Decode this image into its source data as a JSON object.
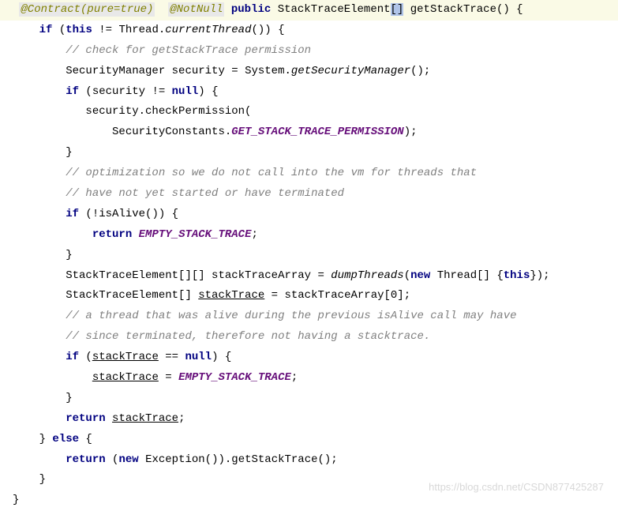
{
  "code": {
    "ann_contract": "@Contract(pure=true)",
    "ann_notnull": "@NotNull",
    "kw_public": "public",
    "type_ste": "StackTraceElement",
    "brackets": "[]",
    "method_name": "getStackTrace",
    "sig_end": "() {",
    "kw_if": "if",
    "kw_this": "this",
    "thread_cur": "Thread.",
    "cur_thread": "currentThread",
    "c_perm": "// check for getStackTrace permission",
    "sm_type": "SecurityManager",
    "sm_var": " security = System.",
    "get_sm": "getSecurityManager",
    "sec_ne": " (security != ",
    "kw_null": "null",
    "check_perm": "security.checkPermission(",
    "sec_const": "SecurityConstants.",
    "gstp": "GET_STACK_TRACE_PERMISSION",
    "close_paren": ");",
    "c_opt1": "// optimization so we do not call into the vm for threads that",
    "c_opt2": "// have not yet started or have terminated",
    "not_alive": " (!isAlive()) {",
    "kw_return": "return",
    "empty_st": "EMPTY_STACK_TRACE",
    "ste_arr2d": "StackTraceElement[][] stackTraceArray = ",
    "dump_threads": "dumpThreads",
    "kw_new": "new",
    "thread_arr": " Thread[] {",
    "close_brace_paren": "});",
    "ste_arr1d": "StackTraceElement[] ",
    "st_var": "stackTrace",
    "eq_sta0": " = stackTraceArray[0];",
    "c_alive1": "// a thread that was alive during the previous isAlive call may have",
    "c_alive2": "// since terminated, therefore not having a stacktrace.",
    "st_eq_null": " == ",
    "eq_empty": " = ",
    "kw_else": "else",
    "exc_new": " Exception()).getStackTrace();"
  },
  "watermark": "https://blog.csdn.net/CSDN877425287"
}
